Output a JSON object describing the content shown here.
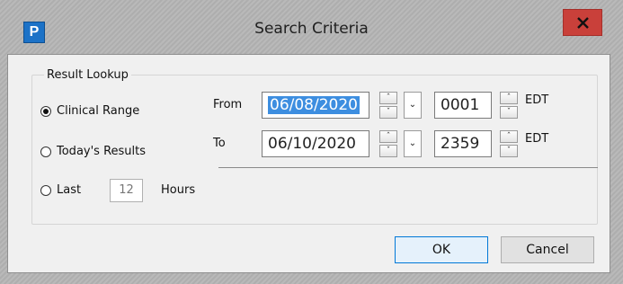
{
  "window": {
    "title": "Search Criteria",
    "close_label": "x"
  },
  "group": {
    "label": "Result Lookup"
  },
  "options": {
    "clinical_range": "Clinical Range",
    "todays_results": "Today's Results",
    "last": "Last",
    "last_value": "12",
    "hours": "Hours",
    "selected": "clinical_range"
  },
  "from": {
    "label": "From",
    "date": "06/08/2020",
    "time": "0001",
    "tz": "EDT"
  },
  "to": {
    "label": "To",
    "date": "06/10/2020",
    "time": "2359",
    "tz": "EDT"
  },
  "buttons": {
    "ok": "OK",
    "cancel": "Cancel"
  },
  "colors": {
    "close": "#c9403a",
    "selection": "#3d8ee0",
    "app_icon": "#1c72c7"
  },
  "icons": {
    "app": "p-app-icon",
    "close": "close-icon",
    "spin_up": "chevron-up-icon",
    "spin_down": "chevron-down-icon",
    "dropdown": "chevron-down-icon"
  }
}
